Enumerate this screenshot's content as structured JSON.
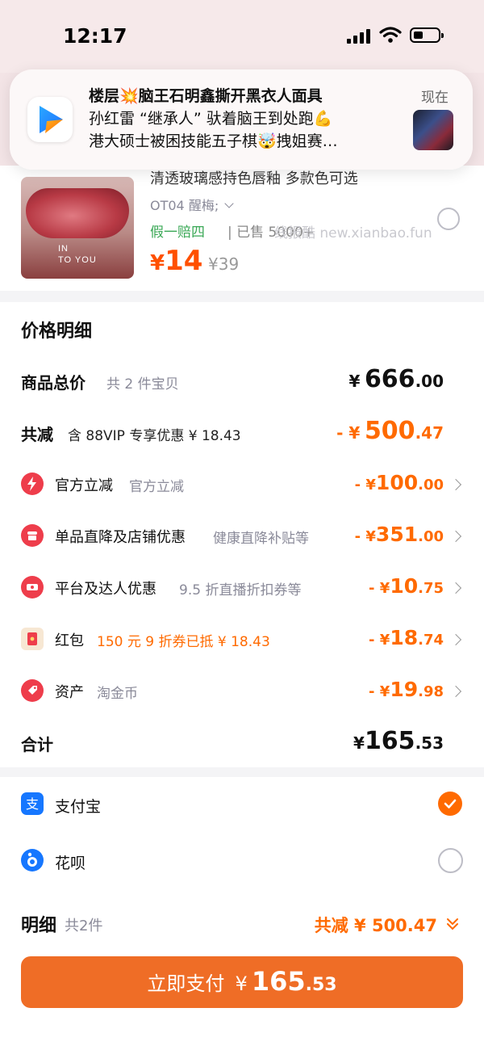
{
  "status_bar": {
    "time": "12:17"
  },
  "notification": {
    "line1": "楼层💥脑王石明鑫撕开黑衣人面具",
    "line2": "孙红雷 “继承人” 驮着脑王到处跑💪",
    "line3": "港大硕士被困技能五子棋🤯拽姐赛…",
    "time": "现在"
  },
  "product": {
    "title": "清透玻璃感持色唇釉 多款色可选",
    "sku": "OT04 醒梅;",
    "guarantee": "假一赔四",
    "sold": "| 已售 5000+",
    "watermark": "线报酷 new.xianbao.fun",
    "price_symbol": "¥",
    "price": "14",
    "original_price": "¥39",
    "thumb_text_1": "IN",
    "thumb_text_2": "TO YOU"
  },
  "price_detail": {
    "heading": "价格明细",
    "total": {
      "label": "商品总价",
      "sub": "共 2 件宝贝",
      "symbol": "¥",
      "big": "666",
      "small": ".00"
    },
    "reduce": {
      "label": "共减",
      "sub": "含 88VIP 专享优惠 ¥ 18.43",
      "symbol": "- ¥",
      "big": "500",
      "small": ".47"
    },
    "items": [
      {
        "name": "官方立减",
        "desc": "官方立减",
        "symbol": "- ¥",
        "big": "100",
        "small": ".00",
        "icon": "lightning-icon"
      },
      {
        "name": "单品直降及店铺优惠",
        "desc": "健康直降补贴等",
        "symbol": "- ¥",
        "big": "351",
        "small": ".00",
        "icon": "shop-icon"
      },
      {
        "name": "平台及达人优惠",
        "desc": "9.5 折直播折扣券等",
        "symbol": "- ¥",
        "big": "10",
        "small": ".75",
        "icon": "ticket-icon"
      },
      {
        "name": "红包",
        "desc": "150 元 9 折券已抵 ¥ 18.43",
        "symbol": "- ¥",
        "big": "18",
        "small": ".74",
        "icon": "red-envelope-icon"
      },
      {
        "name": "资产",
        "desc": "淘金币",
        "symbol": "- ¥",
        "big": "19",
        "small": ".98",
        "icon": "tag-icon"
      }
    ],
    "subtotal": {
      "label": "合计",
      "symbol": "¥",
      "big": "165",
      "small": ".53"
    }
  },
  "payment": {
    "methods": [
      {
        "name": "支付宝",
        "selected": true
      },
      {
        "name": "花呗",
        "selected": false
      }
    ],
    "detail_label": "明细",
    "detail_count": "共2件",
    "detail_saving": "共减 ¥ 500.47",
    "pay_button_label": "立即支付",
    "pay_symbol": "¥",
    "pay_big": "165",
    "pay_small": ".53"
  },
  "colors": {
    "accent": "#ff6a00",
    "button": "#ef6d26",
    "green": "#3aa856",
    "icon_red": "#ee3d4b"
  }
}
